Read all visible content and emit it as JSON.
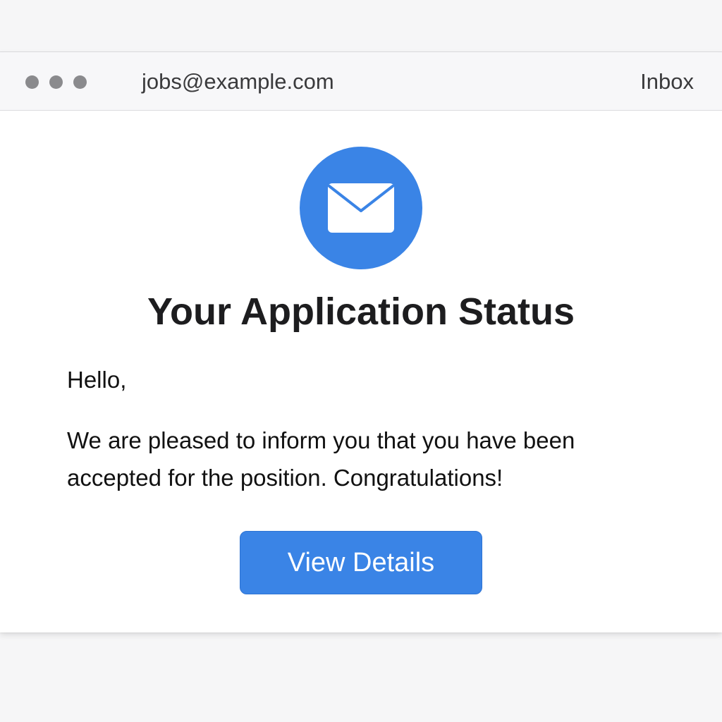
{
  "titlebar": {
    "sender": "jobs@example.com",
    "folder": "Inbox"
  },
  "icons": {
    "window_controls": "dots-icon",
    "mail": "envelope-icon"
  },
  "colors": {
    "accent": "#3a84e6",
    "heading": "#1d1d1f",
    "body_text": "#111111",
    "titlebar_bg": "#f7f7f9",
    "dot": "#8a8a8d"
  },
  "email": {
    "heading": "Your Application Status",
    "greeting": "Hello,",
    "message_line1": "We are pleased to inform you that you have been",
    "message_line2": "accepted for the position. Congratulations!",
    "button_label": "View Details"
  }
}
